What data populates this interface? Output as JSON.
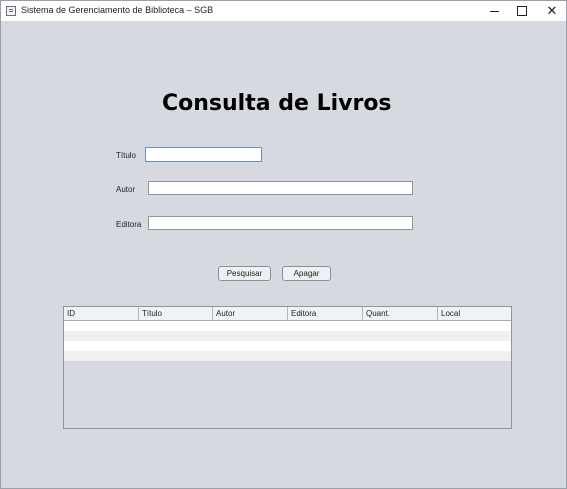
{
  "window": {
    "title": "Sistema de Gerenciamento de Biblioteca – SGB"
  },
  "form": {
    "heading": "Consulta de Livros",
    "titulo_label": "Título",
    "titulo_value": "",
    "autor_label": "Autor",
    "autor_value": "",
    "editora_label": "Editora",
    "editora_value": "",
    "search_button": "Pesquisar",
    "clear_button": "Apagar"
  },
  "table": {
    "columns": [
      "ID",
      "Título",
      "Autor",
      "Editora",
      "Quant.",
      "Local"
    ],
    "rows": [
      "",
      "",
      "",
      ""
    ]
  },
  "colors": {
    "background": "#d6d9e0",
    "row_alt": "#f0f0f0",
    "row": "#ffffff"
  },
  "icons": [
    "app-icon",
    "minimize-icon",
    "maximize-icon",
    "close-icon"
  ]
}
